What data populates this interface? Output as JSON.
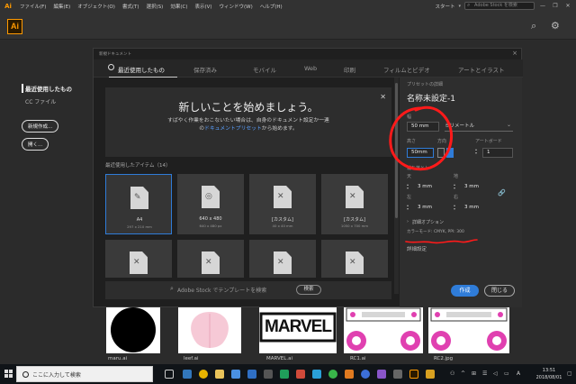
{
  "menubar": {
    "app_logo": "Ai",
    "items": [
      "ファイル(F)",
      "編集(E)",
      "オブジェクト(O)",
      "書式(T)",
      "選択(S)",
      "効果(C)",
      "表示(V)",
      "ウィンドウ(W)",
      "ヘルプ(H)"
    ],
    "start_label": "スタート",
    "stock_search_placeholder": "Adobe Stock を検索",
    "window_controls": [
      "—",
      "❐",
      "✕"
    ]
  },
  "appbar": {
    "badge": "Ai"
  },
  "start_panel": {
    "recent": "最近使用したもの",
    "cc_files": "CC ファイル",
    "new_button": "新規作成...",
    "open_button": "開く..."
  },
  "dialog": {
    "title": "新規ドキュメント",
    "tabs": [
      "最近使用したもの",
      "保存済み",
      "モバイル",
      "Web",
      "印刷",
      "フィルムとビデオ",
      "アートとイラスト"
    ],
    "welcome": {
      "heading": "新しいことを始めましょう。",
      "line1": "すばやく作業をおこないたい場合は、自身のドキュメント設定か一連",
      "line2_pre": "の",
      "line2_link": "ドキュメントプリセット",
      "line2_post": "から始めます。"
    },
    "recent_items_label": "最近使用したアイテム（14）",
    "cards": [
      {
        "name": "A4",
        "dims": "297 x 210 mm"
      },
      {
        "name": "640 x 480",
        "dims": "640 x 480 px"
      },
      {
        "name": "[カスタム]",
        "dims": "40 x 40 mm"
      },
      {
        "name": "[カスタム]",
        "dims": "1050 x 700 mm"
      }
    ],
    "stock_search": "Adobe Stock でテンプレートを検索",
    "stock_button": "検索"
  },
  "preset": {
    "details_label": "プリセットの詳細",
    "name": "名称未設定-1",
    "width_label": "幅",
    "width_value": "50 mm",
    "unit": "ミリメートル",
    "height_label": "高さ",
    "height_value": "50mm",
    "orientation_label": "方向",
    "artboard_label": "アートボード",
    "artboard_value": "1",
    "bleed_label": "裁ち落とし",
    "top_label": "天",
    "bottom_label": "地",
    "left_label": "左",
    "right_label": "右",
    "bleed_top": "3 mm",
    "bleed_bottom": "3 mm",
    "bleed_left": "3 mm",
    "bleed_right": "3 mm",
    "advanced_label": "詳細オプション",
    "color_mode": "カラーモード: CMYK, PPI: 300",
    "more_settings": "詳細設定",
    "create_button": "作成",
    "close_button": "閉じる"
  },
  "thumbnails": [
    "maru.ai",
    "leef.ai",
    "MARVEL.ai",
    "RC1.ai",
    "RC2.jpg"
  ],
  "marvel_logo": "MARVEL",
  "taskbar": {
    "search_placeholder": "ここに入力して検索",
    "time": "13:51",
    "date": "2018/08/01",
    "tray_a": "A"
  },
  "colors": {
    "accent": "#2f7cd8",
    "annotation": "#ff1a1a",
    "ai_orange": "#ff9a00",
    "magenta": "#e040b0"
  }
}
